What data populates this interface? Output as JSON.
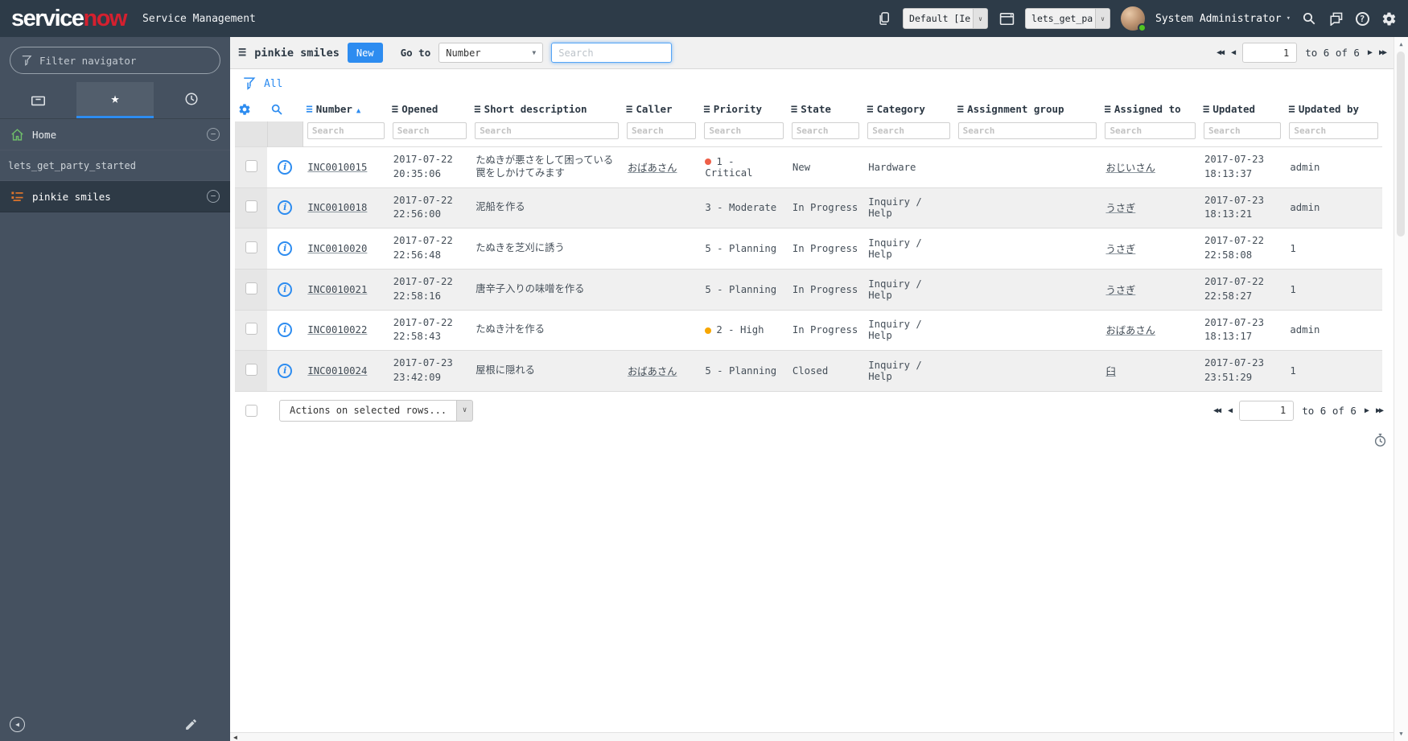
{
  "banner": {
    "logo": {
      "part1": "service",
      "part2": "now"
    },
    "product_name": "Service Management",
    "update_set": {
      "value": "Default [Ie"
    },
    "application": {
      "value": "lets_get_pa"
    },
    "user": {
      "name": "System Administrator"
    }
  },
  "sidebar": {
    "filter": {
      "placeholder": "Filter navigator"
    },
    "nav": {
      "home_label": "Home",
      "app_label": "lets_get_party_started",
      "module_label": "pinkie smiles"
    }
  },
  "list_header": {
    "title": "pinkie smiles",
    "new_button": "New",
    "goto_label": "Go to",
    "goto_value": "Number",
    "search_placeholder": "Search"
  },
  "breadcrumb": {
    "all_label": "All"
  },
  "pagination": {
    "page": "1",
    "range_text": "to 6 of 6"
  },
  "footer": {
    "actions_label": "Actions on selected rows..."
  },
  "table": {
    "search_placeholder": "Search",
    "columns": [
      {
        "label": "Number",
        "key": "number",
        "sorted": "asc",
        "link": true
      },
      {
        "label": "Opened",
        "key": "opened",
        "datetime": true
      },
      {
        "label": "Short description",
        "key": "short_description"
      },
      {
        "label": "Caller",
        "key": "caller",
        "link": true
      },
      {
        "label": "Priority",
        "key": "priority"
      },
      {
        "label": "State",
        "key": "state"
      },
      {
        "label": "Category",
        "key": "category"
      },
      {
        "label": "Assignment group",
        "key": "assignment_group"
      },
      {
        "label": "Assigned to",
        "key": "assigned_to",
        "link": true
      },
      {
        "label": "Updated",
        "key": "updated",
        "datetime": true
      },
      {
        "label": "Updated by",
        "key": "updated_by"
      }
    ],
    "rows": [
      {
        "number": "INC0010015",
        "opened_date": "2017-07-22",
        "opened_time": "20:35:06",
        "short_description": "たぬきが悪さをして困っている 罠をしかけてみます",
        "caller": "おばあさん",
        "priority": "1 - Critical",
        "priority_color": "#ee5f48",
        "state": "New",
        "category": "Hardware",
        "assignment_group": "",
        "assigned_to": "おじいさん",
        "updated_date": "2017-07-23",
        "updated_time": "18:13:37",
        "updated_by": "admin"
      },
      {
        "number": "INC0010018",
        "opened_date": "2017-07-22",
        "opened_time": "22:56:00",
        "short_description": "泥船を作る",
        "caller": "",
        "priority": "3 - Moderate",
        "priority_color": null,
        "state": "In Progress",
        "category": "Inquiry / Help",
        "assignment_group": "",
        "assigned_to": "うさぎ",
        "updated_date": "2017-07-23",
        "updated_time": "18:13:21",
        "updated_by": "admin"
      },
      {
        "number": "INC0010020",
        "opened_date": "2017-07-22",
        "opened_time": "22:56:48",
        "short_description": "たぬきを芝刈に誘う",
        "caller": "",
        "priority": "5 - Planning",
        "priority_color": null,
        "state": "In Progress",
        "category": "Inquiry / Help",
        "assignment_group": "",
        "assigned_to": "うさぎ",
        "updated_date": "2017-07-22",
        "updated_time": "22:58:08",
        "updated_by": "1"
      },
      {
        "number": "INC0010021",
        "opened_date": "2017-07-22",
        "opened_time": "22:58:16",
        "short_description": "唐辛子入りの味噌を作る",
        "caller": "",
        "priority": "5 - Planning",
        "priority_color": null,
        "state": "In Progress",
        "category": "Inquiry / Help",
        "assignment_group": "",
        "assigned_to": "うさぎ",
        "updated_date": "2017-07-22",
        "updated_time": "22:58:27",
        "updated_by": "1"
      },
      {
        "number": "INC0010022",
        "opened_date": "2017-07-22",
        "opened_time": "22:58:43",
        "short_description": "たぬき汁を作る",
        "caller": "",
        "priority": "2 - High",
        "priority_color": "#f7a600",
        "state": "In Progress",
        "category": "Inquiry / Help",
        "assignment_group": "",
        "assigned_to": "おばあさん",
        "updated_date": "2017-07-23",
        "updated_time": "18:13:17",
        "updated_by": "admin"
      },
      {
        "number": "INC0010024",
        "opened_date": "2017-07-23",
        "opened_time": "23:42:09",
        "short_description": "屋根に隠れる",
        "caller": "おばあさん",
        "priority": "5 - Planning",
        "priority_color": null,
        "state": "Closed",
        "category": "Inquiry / Help",
        "assignment_group": "",
        "assigned_to": "臼",
        "updated_date": "2017-07-23",
        "updated_time": "23:51:29",
        "updated_by": "1"
      }
    ]
  },
  "icons": {
    "star": "★",
    "menu": "≡",
    "sort_asc": "▲",
    "caret_down": "▼",
    "chevron_down": "∨",
    "first": "◀◀",
    "prev": "◀",
    "next": "▶",
    "last": "▶▶",
    "scroll_up": "▲",
    "scroll_down": "▼",
    "scroll_left": "◀",
    "minus": "−",
    "collapse": "◀",
    "user_caret": "▾",
    "info": "i",
    "help": "?"
  },
  "colors": {
    "accent": "#2d8cf0",
    "banner_bg": "#2d3b48",
    "sidebar_bg": "#455160",
    "critical_dot": "#ee5f48",
    "high_dot": "#f7a600",
    "logo_red": "#d5202f",
    "presence_online": "#51c521"
  }
}
